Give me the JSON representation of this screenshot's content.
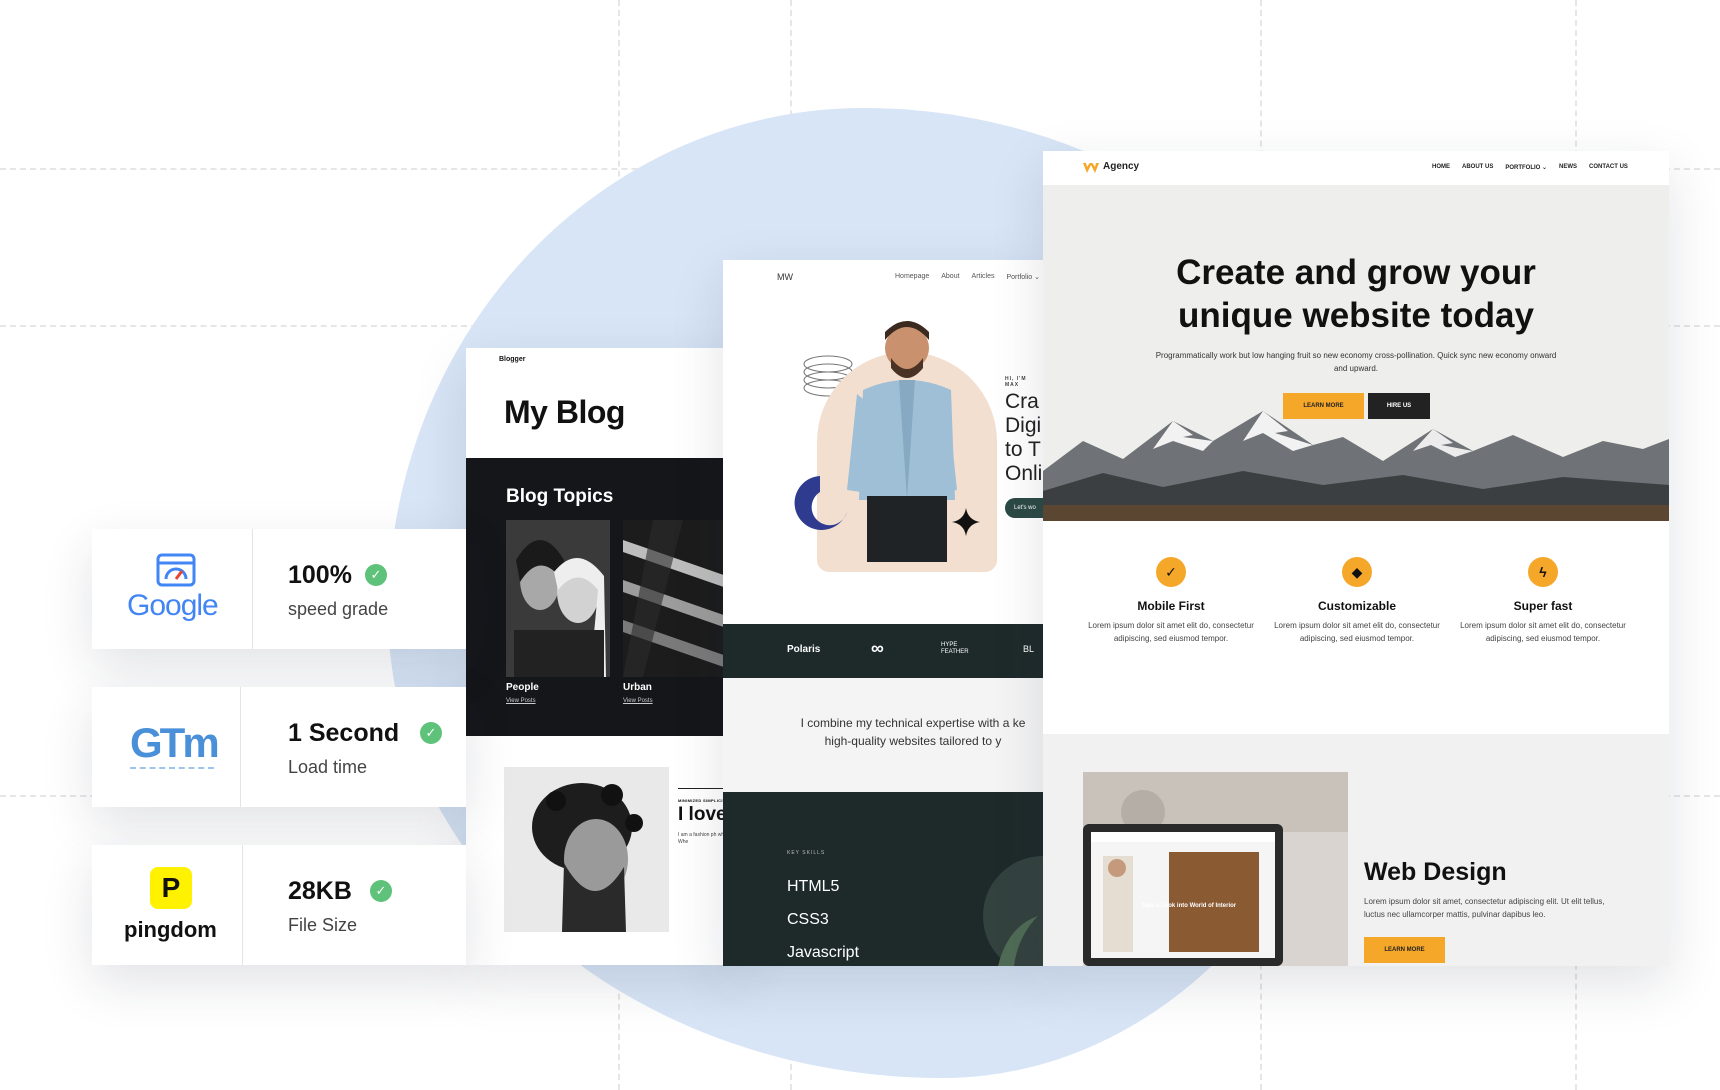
{
  "colors": {
    "accent": "#f5a72a",
    "blob": "#d7e5f6",
    "dark": "#15161a",
    "teal_dark": "#1e2a2a",
    "check": "#5fc27a"
  },
  "stats": [
    {
      "brand": "Google",
      "value": "100%",
      "label": "speed grade"
    },
    {
      "brand": "GTm",
      "value": "1 Second",
      "label": "Load time"
    },
    {
      "brand": "pingdom",
      "value": "28KB",
      "label": "File Size"
    }
  ],
  "blog": {
    "brand": "Blogger",
    "title": "My Blog",
    "topics_title": "Blog Topics",
    "topics": [
      {
        "label": "People",
        "link": "View Posts"
      },
      {
        "label": "Urban",
        "link": "View Posts"
      }
    ],
    "mini_label": "MINIMIZED SIMPLICITY",
    "post_title": "I love",
    "post_desc": "I am a fashion ph whole story. Whe"
  },
  "portfolio": {
    "logo": "MW",
    "nav": [
      "Homepage",
      "About",
      "Articles",
      "Portfolio ⌄"
    ],
    "greeting": "HI, I'M MAX",
    "headline": "Cra\nDigi\nto T\nOnli",
    "cta": "Let's wo",
    "clients": [
      "Polaris",
      "∞",
      "HYPE FEATHER",
      "BL"
    ],
    "intro_line1": "I combine my technical expertise with a ke",
    "intro_line2": "high-quality websites tailored to y",
    "skills_label": "KEY SKILLS",
    "skills": [
      "HTML5",
      "CSS3",
      "Javascript"
    ]
  },
  "agency": {
    "logo": "Agency",
    "nav": [
      "HOME",
      "ABOUT US",
      "PORTFOLIO ⌄",
      "NEWS",
      "CONTACT US"
    ],
    "hero_title_line1": "Create and grow your",
    "hero_title_line2": "unique website today",
    "hero_sub": "Programmatically work but low hanging fruit so new economy cross-pollination. Quick sync new economy onward and upward.",
    "btn_primary": "LEARN MORE",
    "btn_secondary": "HIRE US",
    "features": [
      {
        "icon": "check-icon",
        "glyph": "✓",
        "title": "Mobile First",
        "desc": "Lorem ipsum dolor sit amet elit do, consectetur adipiscing, sed eiusmod tempor."
      },
      {
        "icon": "diamond-icon",
        "glyph": "◆",
        "title": "Customizable",
        "desc": "Lorem ipsum dolor sit amet elit do, consectetur adipiscing, sed eiusmod tempor."
      },
      {
        "icon": "lightning-icon",
        "glyph": "ϟ",
        "title": "Super fast",
        "desc": "Lorem ipsum dolor sit amet elit do, consectetur adipiscing, sed eiusmod tempor."
      }
    ],
    "service_title": "Web Design",
    "service_desc": "Lorem ipsum dolor sit amet, consectetur adipiscing elit. Ut elit tellus, luctus nec ullamcorper mattis, pulvinar dapibus leo.",
    "service_btn": "LEARN MORE",
    "laptop_text": "Take a Look into World of Interior Designer and Stylist Brody Talbert"
  }
}
